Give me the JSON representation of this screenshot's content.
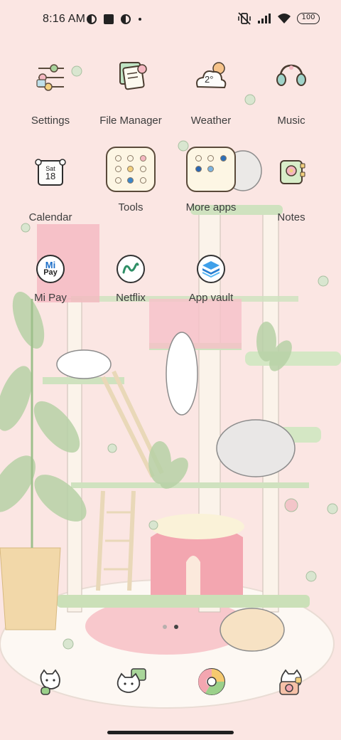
{
  "status_bar": {
    "time": "8:16 AM",
    "battery": "100",
    "left_icons": [
      "notification-badge-icon",
      "square-app-icon",
      "notification-badge-icon",
      "dot-icon"
    ],
    "right_icons": [
      "vibrate-muted-icon",
      "cell-signal-icon",
      "wifi-icon",
      "battery-icon"
    ]
  },
  "apps": [
    {
      "name": "settings",
      "label": "Settings",
      "icon": "settings-sliders-icon"
    },
    {
      "name": "file-manager",
      "label": "File Manager",
      "icon": "file-manager-icon"
    },
    {
      "name": "weather",
      "label": "Weather",
      "icon": "weather-cloud-icon",
      "temperature": "2°"
    },
    {
      "name": "music",
      "label": "Music",
      "icon": "music-headphones-icon"
    },
    {
      "name": "calendar",
      "label": "Calendar",
      "icon": "calendar-icon",
      "day": "Sat",
      "date": "18"
    },
    {
      "name": "tools",
      "label": "Tools",
      "icon": "tools-folder-icon"
    },
    {
      "name": "more-apps",
      "label": "More apps",
      "icon": "more-apps-folder-icon"
    },
    {
      "name": "notes",
      "label": "Notes",
      "icon": "notes-icon"
    },
    {
      "name": "mi-pay",
      "label": "Mi Pay",
      "icon": "mi-pay-icon",
      "badge_top": "Mi",
      "badge_bottom": "Pay"
    },
    {
      "name": "netflix",
      "label": "Netflix",
      "icon": "netflix-icon"
    },
    {
      "name": "app-vault",
      "label": "App vault",
      "icon": "app-vault-icon"
    }
  ],
  "pages": {
    "count": 2,
    "active_index": 1
  },
  "dock": [
    {
      "name": "dock-phone",
      "icon": "phone-cat-icon"
    },
    {
      "name": "dock-messages",
      "icon": "messages-cat-icon"
    },
    {
      "name": "dock-browser",
      "icon": "browser-icon"
    },
    {
      "name": "dock-camera",
      "icon": "camera-cat-icon"
    }
  ],
  "colors": {
    "background": "#fbe6e3",
    "shelf_green": "#cfe2bf",
    "accent_pink": "#f3a6b0",
    "icon_outline": "#4a3c30"
  }
}
